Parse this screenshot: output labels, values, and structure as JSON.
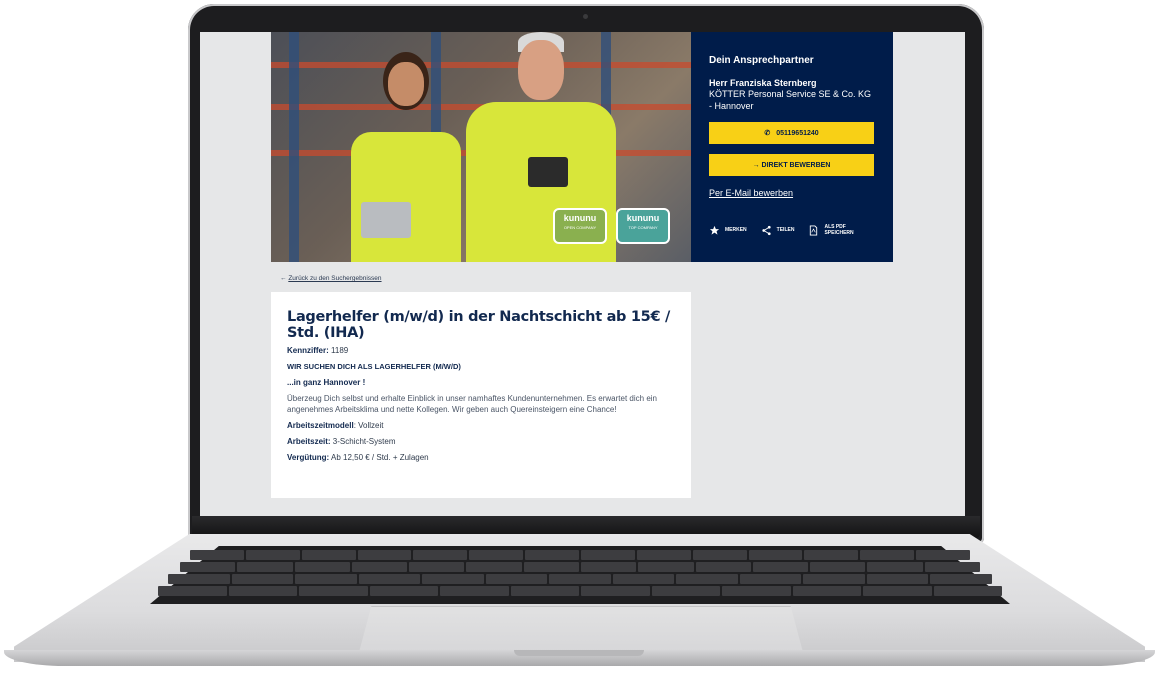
{
  "contact": {
    "heading": "Dein Ansprechpartner",
    "name": "Herr Franziska Sternberg",
    "company": "KÖTTER Personal Service SE & Co. KG - Hannover",
    "phone": "05119651240",
    "apply_label": "→ DIREKT BEWERBEN",
    "email_label": "Per E-Mail bewerben",
    "actions": [
      {
        "label": "MERKEN",
        "icon": "star-icon"
      },
      {
        "label": "TEILEN",
        "icon": "share-icon"
      },
      {
        "label": "ALS PDF SPEICHERN",
        "icon": "pdf-icon"
      }
    ]
  },
  "hero": {
    "badges": [
      {
        "brand": "kununu",
        "text": "OPEN COMPANY"
      },
      {
        "brand": "kununu",
        "text": "TOP COMPANY"
      }
    ]
  },
  "back_link": "Zurück zu den Suchergebnissen",
  "job": {
    "title": "Lagerhelfer (m/w/d) in der Nachtschicht ab 15€ / Std. (IHA)",
    "id_label": "Kennziffer:",
    "id_value": "1189",
    "headline": "WIR SUCHEN DICH ALS LAGERHELFER (M/W/D)",
    "subline": "...in ganz Hannover !",
    "intro": "Überzeug Dich selbst und erhalte Einblick in unser namhaftes Kundenunternehmen. Es erwartet dich ein angenehmes Arbeitsklima und nette Kollegen. Wir geben auch Quereinsteigern eine Chance!",
    "model_label": "Arbeitszeitmodell",
    "model_value": ": Vollzeit",
    "time_label": "Arbeitszeit:",
    "time_value": "3-Schicht-System",
    "pay_label": "Vergütung:",
    "pay_value": "Ab 12,50 € / Std. + Zulagen"
  },
  "colors": {
    "navy": "#001c4a",
    "yellow": "#f8d016",
    "page_bg": "#e6e7e8"
  }
}
